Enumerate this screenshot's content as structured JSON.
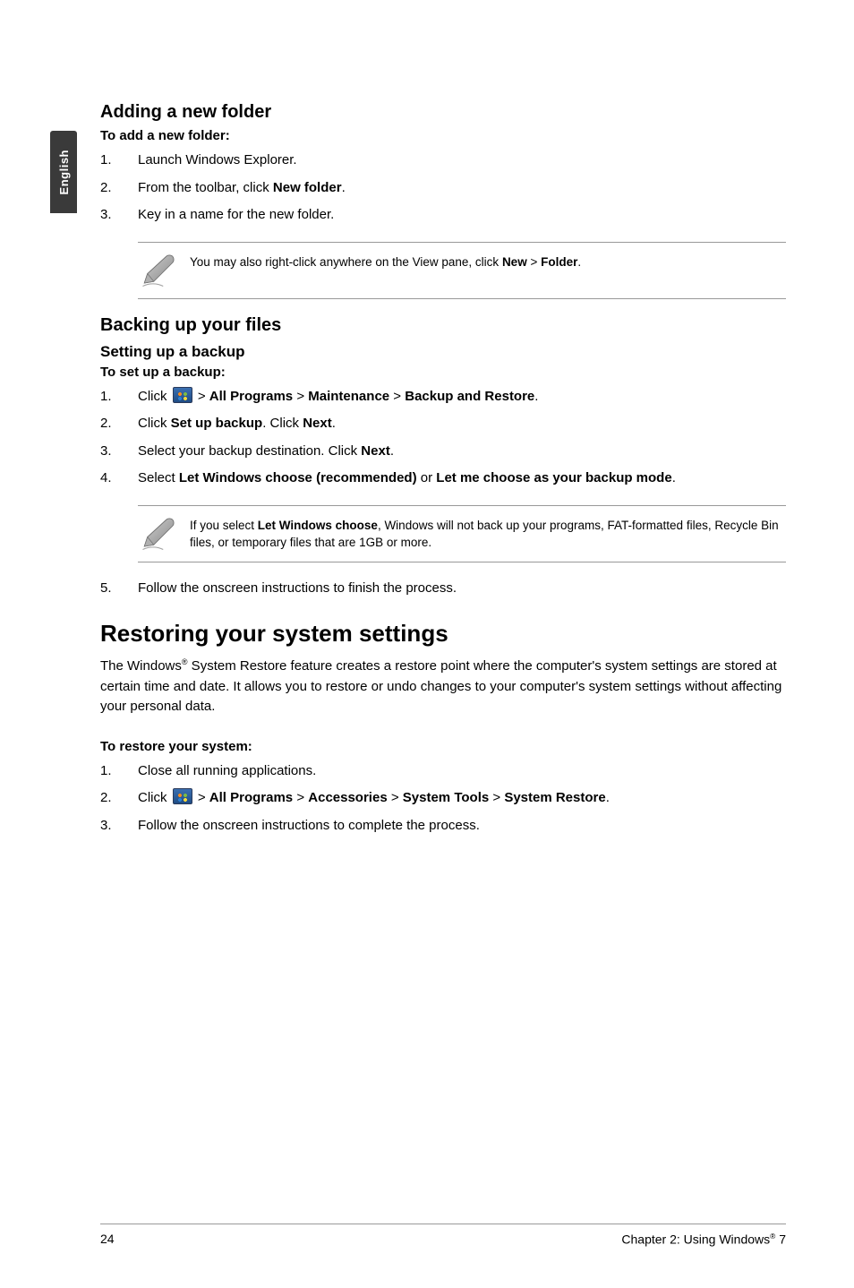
{
  "side_tab": "English",
  "section1": {
    "heading": "Adding a new folder",
    "lead_bold": "To add a new folder:",
    "steps": [
      {
        "n": "1.",
        "text": "Launch Windows Explorer."
      },
      {
        "n": "2.",
        "pre": "From the toolbar, click ",
        "b1": "New folder",
        "post": "."
      },
      {
        "n": "3.",
        "text": "Key in a name for the new folder."
      }
    ],
    "note": {
      "pre": "You may also right-click anywhere on the View pane, click ",
      "b1": "New",
      "mid": " > ",
      "b2": "Folder",
      "post": "."
    }
  },
  "section2": {
    "heading": "Backing up your files",
    "sub": "Setting up a backup",
    "lead_bold": "To set up a backup:",
    "steps": [
      {
        "n": "1.",
        "pre": "Click ",
        "icon": true,
        "mid1": " > ",
        "b1": "All Programs",
        "mid2": " > ",
        "b2": "Maintenance",
        "mid3": " > ",
        "b3": "Backup and Restore",
        "post": "."
      },
      {
        "n": "2.",
        "pre": "Click ",
        "b1": "Set up backup",
        "mid1": ". Click ",
        "b2": "Next",
        "post": "."
      },
      {
        "n": "3.",
        "pre": "Select your backup destination. Click ",
        "b1": "Next",
        "post": "."
      },
      {
        "n": "4.",
        "pre": "Select ",
        "b1": "Let Windows choose (recommended)",
        "mid1": " or ",
        "b2": "Let me choose as your backup mode",
        "post": "."
      }
    ],
    "note": {
      "pre": "If you select ",
      "b1": "Let Windows choose",
      "post": ", Windows will not back up your programs, FAT-formatted files, Recycle Bin files, or temporary files that are 1GB or more."
    },
    "step5": {
      "n": "5.",
      "text": "Follow the onscreen instructions to finish the process."
    }
  },
  "section3": {
    "heading": "Restoring your system settings",
    "para": {
      "pre": "The Windows",
      "sup": "®",
      "post": " System Restore feature creates a restore point where the computer's system settings are stored at certain time and date. It allows you to restore or undo changes to your computer's system settings without affecting your personal data."
    },
    "lead_bold": "To restore your system:",
    "steps": [
      {
        "n": "1.",
        "text": "Close all running applications."
      },
      {
        "n": "2.",
        "pre": "Click ",
        "icon": true,
        "mid1": " > ",
        "b1": "All Programs",
        "mid2": " > ",
        "b2": "Accessories",
        "mid3": " > ",
        "b3": "System Tools",
        "mid4": " > ",
        "b4": "System Restore",
        "post": "."
      },
      {
        "n": "3.",
        "text": "Follow the onscreen instructions to complete the process."
      }
    ]
  },
  "footer": {
    "left": "24",
    "right_pre": "Chapter 2: Using Windows",
    "right_sup": "®",
    "right_post": " 7"
  }
}
